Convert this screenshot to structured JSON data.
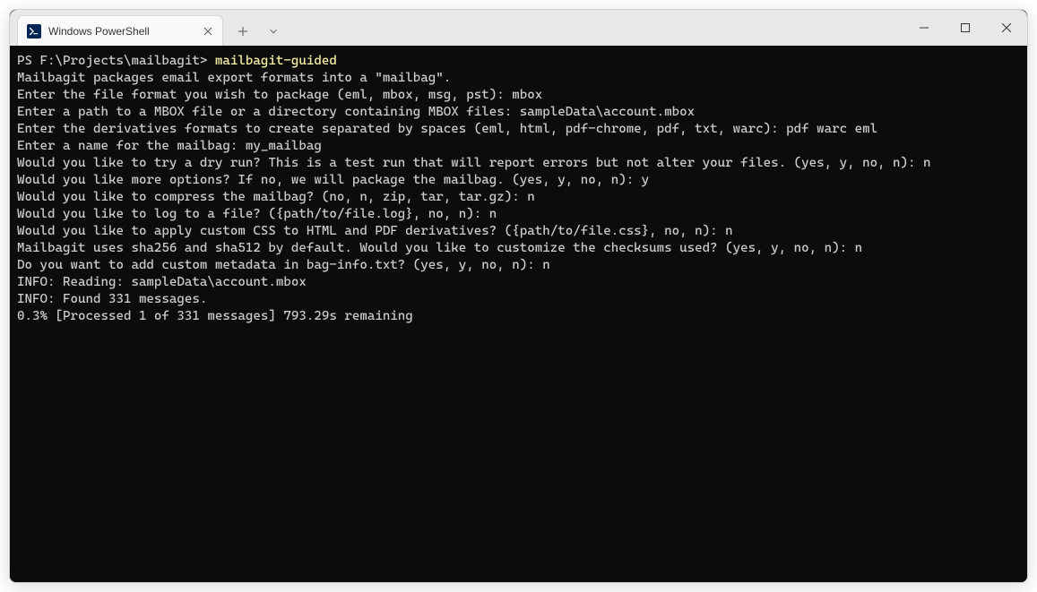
{
  "titlebar": {
    "tab": {
      "title": "Windows PowerShell",
      "icon_label": "powershell-icon"
    }
  },
  "terminal": {
    "prompt": "PS F:\\Projects\\mailbagit> ",
    "command": "mailbagit-guided",
    "lines": [
      "Mailbagit packages email export formats into a \"mailbag\".",
      "Enter the file format you wish to package (eml, mbox, msg, pst): mbox",
      "Enter a path to a MBOX file or a directory containing MBOX files: sampleData\\account.mbox",
      "Enter the derivatives formats to create separated by spaces (eml, html, pdf-chrome, pdf, txt, warc): pdf warc eml",
      "Enter a name for the mailbag: my_mailbag",
      "Would you like to try a dry run? This is a test run that will report errors but not alter your files. (yes, y, no, n): n",
      "Would you like more options? If no, we will package the mailbag. (yes, y, no, n): y",
      "Would you like to compress the mailbag? (no, n, zip, tar, tar.gz): n",
      "Would you like to log to a file? ({path/to/file.log}, no, n): n",
      "Would you like to apply custom CSS to HTML and PDF derivatives? ({path/to/file.css}, no, n): n",
      "Mailbagit uses sha256 and sha512 by default. Would you like to customize the checksums used? (yes, y, no, n): n",
      "Do you want to add custom metadata in bag-info.txt? (yes, y, no, n): n",
      "INFO: Reading: sampleData\\account.mbox",
      "INFO: Found 331 messages.",
      "0.3% [Processed 1 of 331 messages] 793.29s remaining"
    ]
  }
}
